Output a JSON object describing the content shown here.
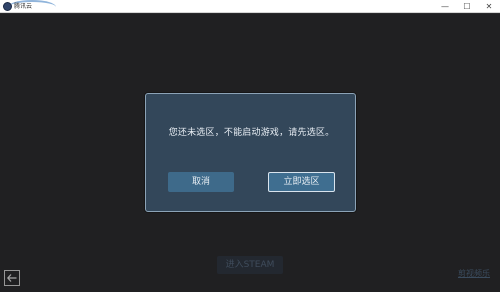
{
  "window": {
    "title": "腾讯云",
    "buttons": {
      "minimize": "—",
      "maximize": "☐",
      "close": "✕"
    }
  },
  "game": {
    "enter_steam_label": "进入STEAM",
    "corner_link_label": "剪视频乐"
  },
  "dialog": {
    "message": "您还未选区，不能启动游戏，请先选区。",
    "cancel_label": "取消",
    "confirm_label": "立即选区"
  },
  "colors": {
    "dialog_bg": "#33475a",
    "dialog_border": "#8ca3b7",
    "button_bg": "#3e6a8a"
  }
}
